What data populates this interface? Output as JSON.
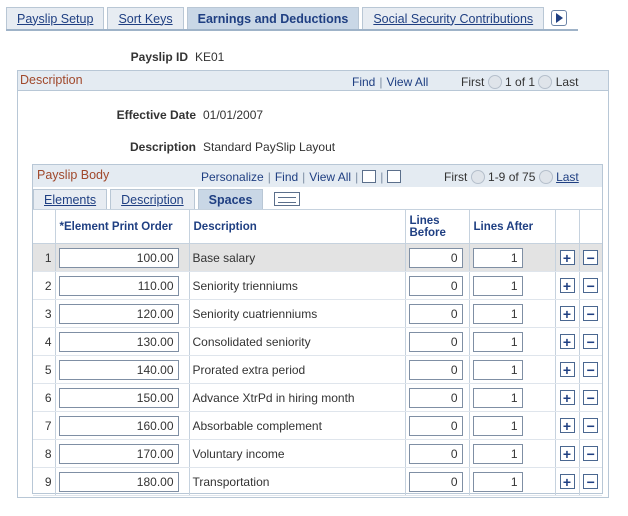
{
  "tabs": [
    {
      "label": "Payslip Setup",
      "active": false
    },
    {
      "label": "Sort Keys",
      "active": false
    },
    {
      "label": "Earnings and Deductions",
      "active": true
    },
    {
      "label": "Social Security Contributions",
      "active": false
    }
  ],
  "header": {
    "payslip_id_label": "Payslip ID",
    "payslip_id_value": "KE01"
  },
  "description_box": {
    "title": "Description",
    "find": "Find",
    "view_all": "View All",
    "first": "First",
    "range": "1 of 1",
    "last": "Last",
    "effective_date_label": "Effective Date",
    "effective_date_value": "01/01/2007",
    "description_label": "Description",
    "description_value": "Standard PaySlip Layout"
  },
  "payslip_body": {
    "title": "Payslip Body",
    "personalize": "Personalize",
    "find": "Find",
    "view_all": "View All",
    "first": "First",
    "range": "1-9 of 75",
    "last": "Last",
    "tabs": [
      {
        "label": "Elements",
        "active": false
      },
      {
        "label": "Description",
        "active": false
      },
      {
        "label": "Spaces",
        "active": true
      }
    ],
    "columns": {
      "print_order": "*Element Print Order",
      "description": "Description",
      "lines_before": "Lines Before",
      "lines_after": "Lines After"
    },
    "add_symbol": "+",
    "remove_symbol": "−",
    "rows": [
      {
        "num": "1",
        "order": "100.00",
        "desc": "Base salary",
        "before": "0",
        "after": "1"
      },
      {
        "num": "2",
        "order": "110.00",
        "desc": "Seniority trienniums",
        "before": "0",
        "after": "1"
      },
      {
        "num": "3",
        "order": "120.00",
        "desc": "Seniority cuatrienniums",
        "before": "0",
        "after": "1"
      },
      {
        "num": "4",
        "order": "130.00",
        "desc": "Consolidated seniority",
        "before": "0",
        "after": "1"
      },
      {
        "num": "5",
        "order": "140.00",
        "desc": "Prorated extra period",
        "before": "0",
        "after": "1"
      },
      {
        "num": "6",
        "order": "150.00",
        "desc": "Advance XtrPd in hiring month",
        "before": "0",
        "after": "1"
      },
      {
        "num": "7",
        "order": "160.00",
        "desc": "Absorbable complement",
        "before": "0",
        "after": "1"
      },
      {
        "num": "8",
        "order": "170.00",
        "desc": "Voluntary income",
        "before": "0",
        "after": "1"
      },
      {
        "num": "9",
        "order": "180.00",
        "desc": "Transportation",
        "before": "0",
        "after": "1"
      }
    ]
  },
  "colors": {
    "link": "#1f3f82",
    "section_title": "#a0482b",
    "header_bg": "#e4ebf2",
    "selected_row": "#e3e3e3"
  }
}
